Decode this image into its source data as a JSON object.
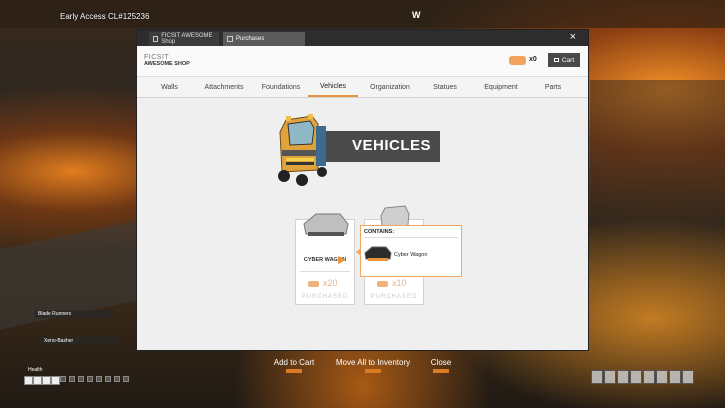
{
  "hud": {
    "build": "Early Access CL#125236",
    "compass": "W"
  },
  "window": {
    "tabs": [
      {
        "label": "FICSIT AWESOME Shop"
      },
      {
        "label": "Purchases"
      }
    ],
    "close_label": "×"
  },
  "shop": {
    "logo_line1": "FICSIT",
    "logo_line2": "AWESOME SHOP",
    "coupon_count": "x0",
    "cart_label": "Cart",
    "accent_color": "#e9953f"
  },
  "categories": [
    "Walls",
    "Attachments",
    "Foundations",
    "Vehicles",
    "Organization",
    "Statues",
    "Equipment",
    "Parts"
  ],
  "active_category": "Vehicles",
  "hero": {
    "title": "VEHICLES"
  },
  "cards": [
    {
      "name": "CYBER WAGON",
      "price": "x20",
      "status": "PURCHASED"
    },
    {
      "name": "",
      "price": "x10",
      "status": "PURCHASED"
    }
  ],
  "tooltip": {
    "header": "CONTAINS:",
    "item": "Cyber Wagon"
  },
  "actions": [
    {
      "label": "Add to Cart"
    },
    {
      "label": "Move All to Inventory"
    },
    {
      "label": "Close"
    }
  ],
  "player": {
    "teammate1": "Blade Runners",
    "teammate2": "Xeno-Basher",
    "health_label": "Health",
    "health_segments_filled": 4,
    "health_segments_total": 12
  }
}
